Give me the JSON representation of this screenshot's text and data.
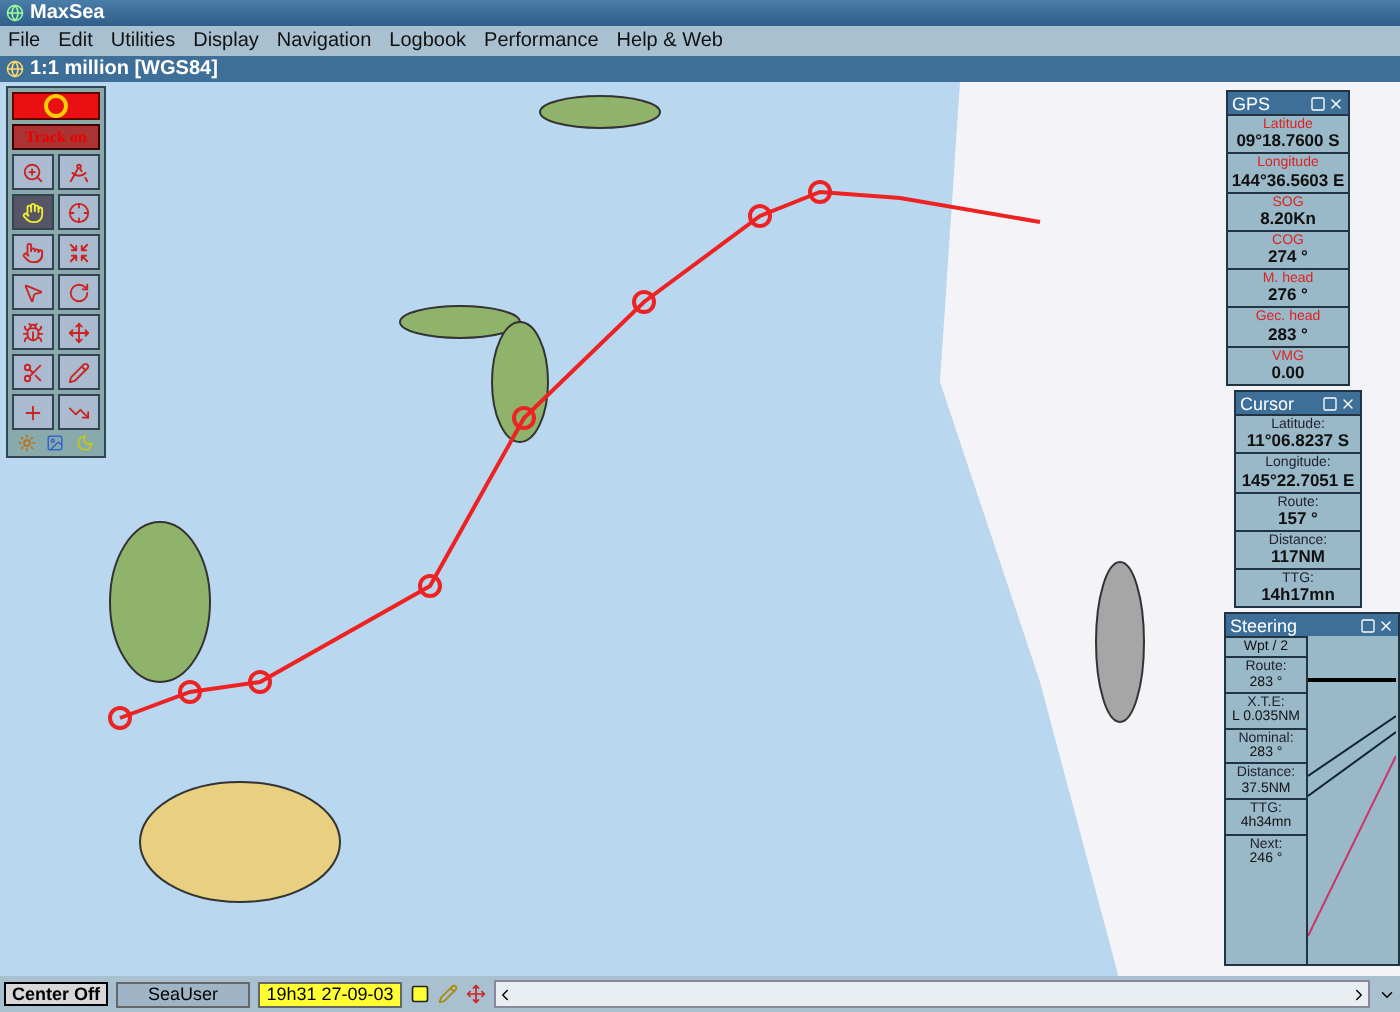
{
  "app_title": "MaxSea",
  "menu": [
    "File",
    "Edit",
    "Utilities",
    "Display",
    "Navigation",
    "Logbook",
    "Performance",
    "Help & Web"
  ],
  "chart_window": {
    "title": "1:1 million [WGS84]"
  },
  "toolbar": {
    "track_button": {
      "label": "Track on",
      "on": true
    },
    "tools": [
      {
        "selected": false
      },
      {
        "selected": false
      },
      {
        "selected": true
      },
      {
        "selected": false
      },
      {
        "selected": false
      },
      {
        "selected": false
      },
      {
        "selected": false
      },
      {
        "selected": false
      },
      {
        "selected": false
      },
      {
        "selected": false
      },
      {
        "selected": false
      },
      {
        "selected": false
      },
      {
        "selected": false
      },
      {
        "selected": false
      }
    ]
  },
  "gps": {
    "title": "GPS",
    "fields": [
      {
        "label": "Latitude",
        "value": "09°18.7600 S"
      },
      {
        "label": "Longitude",
        "value": "144°36.5603 E"
      },
      {
        "label": "SOG",
        "value": "8.20Kn"
      },
      {
        "label": "COG",
        "value": "274 °"
      },
      {
        "label": "M. head",
        "value": "276 °"
      },
      {
        "label": "Gec. head",
        "value": "283 °"
      },
      {
        "label": "VMG",
        "value": "0.00"
      }
    ]
  },
  "cursor": {
    "title": "Cursor",
    "fields": [
      {
        "label": "Latitude:",
        "value": "11°06.8237 S"
      },
      {
        "label": "Longitude:",
        "value": "145°22.7051 E"
      },
      {
        "label": "Route:",
        "value": "157 °"
      },
      {
        "label": "Distance:",
        "value": "117NM"
      },
      {
        "label": "TTG:",
        "value": "14h17mn"
      }
    ]
  },
  "steering": {
    "title": "Steering",
    "waypoint": "Wpt / 2",
    "fields": [
      {
        "label": "Route:",
        "value": "283 °"
      },
      {
        "label": "X.T.E:",
        "value": "L 0.035NM"
      },
      {
        "label": "Nominal:",
        "value": "283 °"
      },
      {
        "label": "Distance:",
        "value": "37.5NM"
      },
      {
        "label": "TTG:",
        "value": "4h34mn"
      },
      {
        "label": "Next:",
        "value": "246 °"
      }
    ]
  },
  "status_bar": {
    "center_button": "Center Off",
    "user": "SeaUser",
    "time": "19h31 27-09-03"
  }
}
